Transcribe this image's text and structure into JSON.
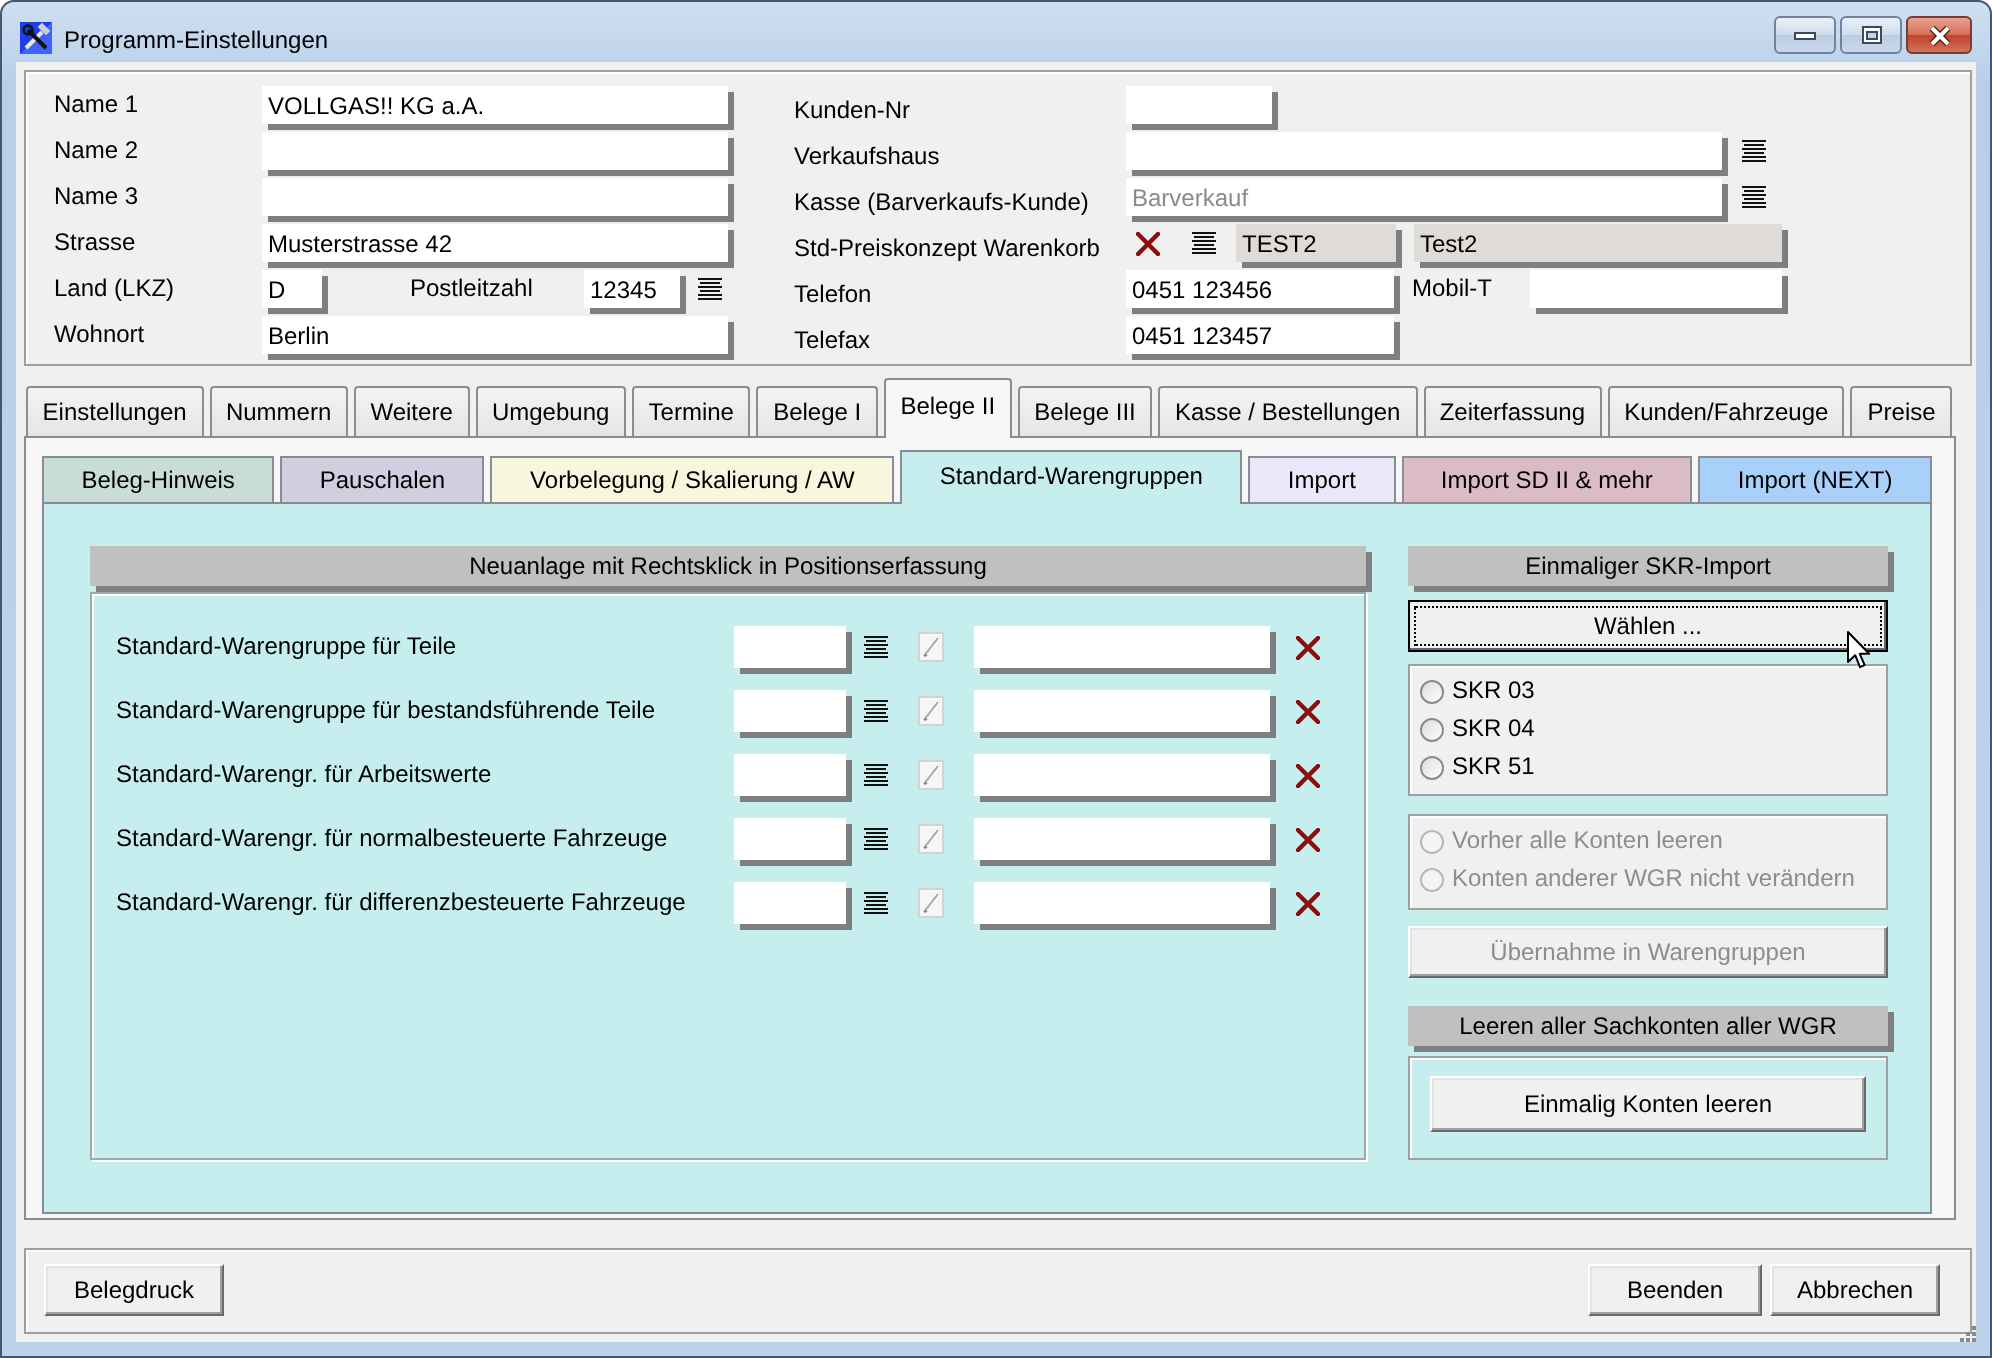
{
  "window": {
    "title": "Programm-Einstellungen"
  },
  "address": [
    {
      "kind": "text",
      "label": "Name 1",
      "value": "VOLLGAS!! KG a.A."
    },
    {
      "kind": "text",
      "label": "Name 2"
    },
    {
      "kind": "text",
      "label": "Name 3"
    },
    {
      "kind": "text",
      "label": "Strasse",
      "value": "Musterstrasse 42"
    },
    {
      "kind": "country_zip",
      "label": "Land (LKZ)",
      "value": "D",
      "zip_label": "Postleitzahl",
      "zip_value": "12345"
    },
    {
      "kind": "text",
      "label": "Wohnort",
      "value": "Berlin"
    }
  ],
  "customer": [
    {
      "kind": "short",
      "label": "Kunden-Nr"
    },
    {
      "kind": "lookup",
      "label": "Verkaufshaus"
    },
    {
      "kind": "lookup",
      "label": "Kasse (Barverkaufs-Kunde)",
      "placeholder": "Barverkauf"
    },
    {
      "kind": "price_concept",
      "label": "Std-Preiskonzept Warenkorb",
      "code": "TEST2",
      "name": "Test2"
    },
    {
      "kind": "phone",
      "label": "Telefon",
      "value": "0451 123456",
      "extra_label": "Mobil-T"
    },
    {
      "kind": "phone",
      "label": "Telefax",
      "value": "0451 123457"
    }
  ],
  "tabs": [
    {
      "label": "Einstellungen",
      "selected": false
    },
    {
      "label": "Nummern",
      "selected": false
    },
    {
      "label": "Weitere",
      "selected": false
    },
    {
      "label": "Umgebung",
      "selected": false
    },
    {
      "label": "Termine",
      "selected": false
    },
    {
      "label": "Belege I",
      "selected": false
    },
    {
      "label": "Belege II",
      "selected": true
    },
    {
      "label": "Belege III",
      "selected": false
    },
    {
      "label": "Kasse / Bestellungen",
      "selected": false
    },
    {
      "label": "Zeiterfassung",
      "selected": false
    },
    {
      "label": "Kunden/Fahrzeuge",
      "selected": false
    },
    {
      "label": "Preise",
      "selected": false
    }
  ],
  "subtabs": [
    {
      "label": "Beleg-Hinweis",
      "selected": false,
      "color": "#c8dcd8"
    },
    {
      "label": "Pauschalen",
      "selected": false,
      "color": "#d2cee0"
    },
    {
      "label": "Vorbelegung / Skalierung / AW",
      "selected": false,
      "color": "#f8f6dc"
    },
    {
      "label": "Standard-Warengruppen",
      "selected": true,
      "color": "#c6eeee"
    },
    {
      "label": "Import",
      "selected": false,
      "color": "#e8e8fa"
    },
    {
      "label": "Import SD II & mehr",
      "selected": false,
      "color": "#dcbcc4"
    },
    {
      "label": "Import (NEXT)",
      "selected": false,
      "color": "#a8d0f8"
    }
  ],
  "default_groups": {
    "title": "Neuanlage mit Rechtsklick in Positionserfassung",
    "rows": [
      {
        "label": "Standard-Warengruppe für Teile"
      },
      {
        "label": "Standard-Warengruppe für bestandsführende Teile"
      },
      {
        "label": "Standard-Warengr. für Arbeitswerte"
      },
      {
        "label": "Standard-Warengr. für normalbesteuerte Fahrzeuge"
      },
      {
        "label": "Standard-Warengr. für differenzbesteuerte Fahrzeuge"
      }
    ]
  },
  "skr_import": {
    "title": "Einmaliger SKR-Import",
    "choose_button": {
      "label": "Wählen ...",
      "focused": true
    },
    "options": [
      {
        "label": "SKR 03",
        "selected": false
      },
      {
        "label": "SKR 04",
        "selected": false
      },
      {
        "label": "SKR 51",
        "selected": false
      }
    ],
    "mode_options": [
      {
        "label": "Vorher alle Konten leeren",
        "selected": false,
        "disabled": true
      },
      {
        "label": "Konten anderer WGR nicht verändern",
        "selected": false,
        "disabled": true
      }
    ],
    "apply_button": {
      "label": "Übernahme in Warengruppen",
      "disabled": true
    }
  },
  "clear_accounts": {
    "title": "Leeren aller Sachkonten aller WGR",
    "button": "Einmalig Konten leeren"
  },
  "footer": {
    "left_buttons": [
      "Belegdruck"
    ],
    "right_buttons": [
      "Beenden",
      "Abbrechen"
    ]
  }
}
